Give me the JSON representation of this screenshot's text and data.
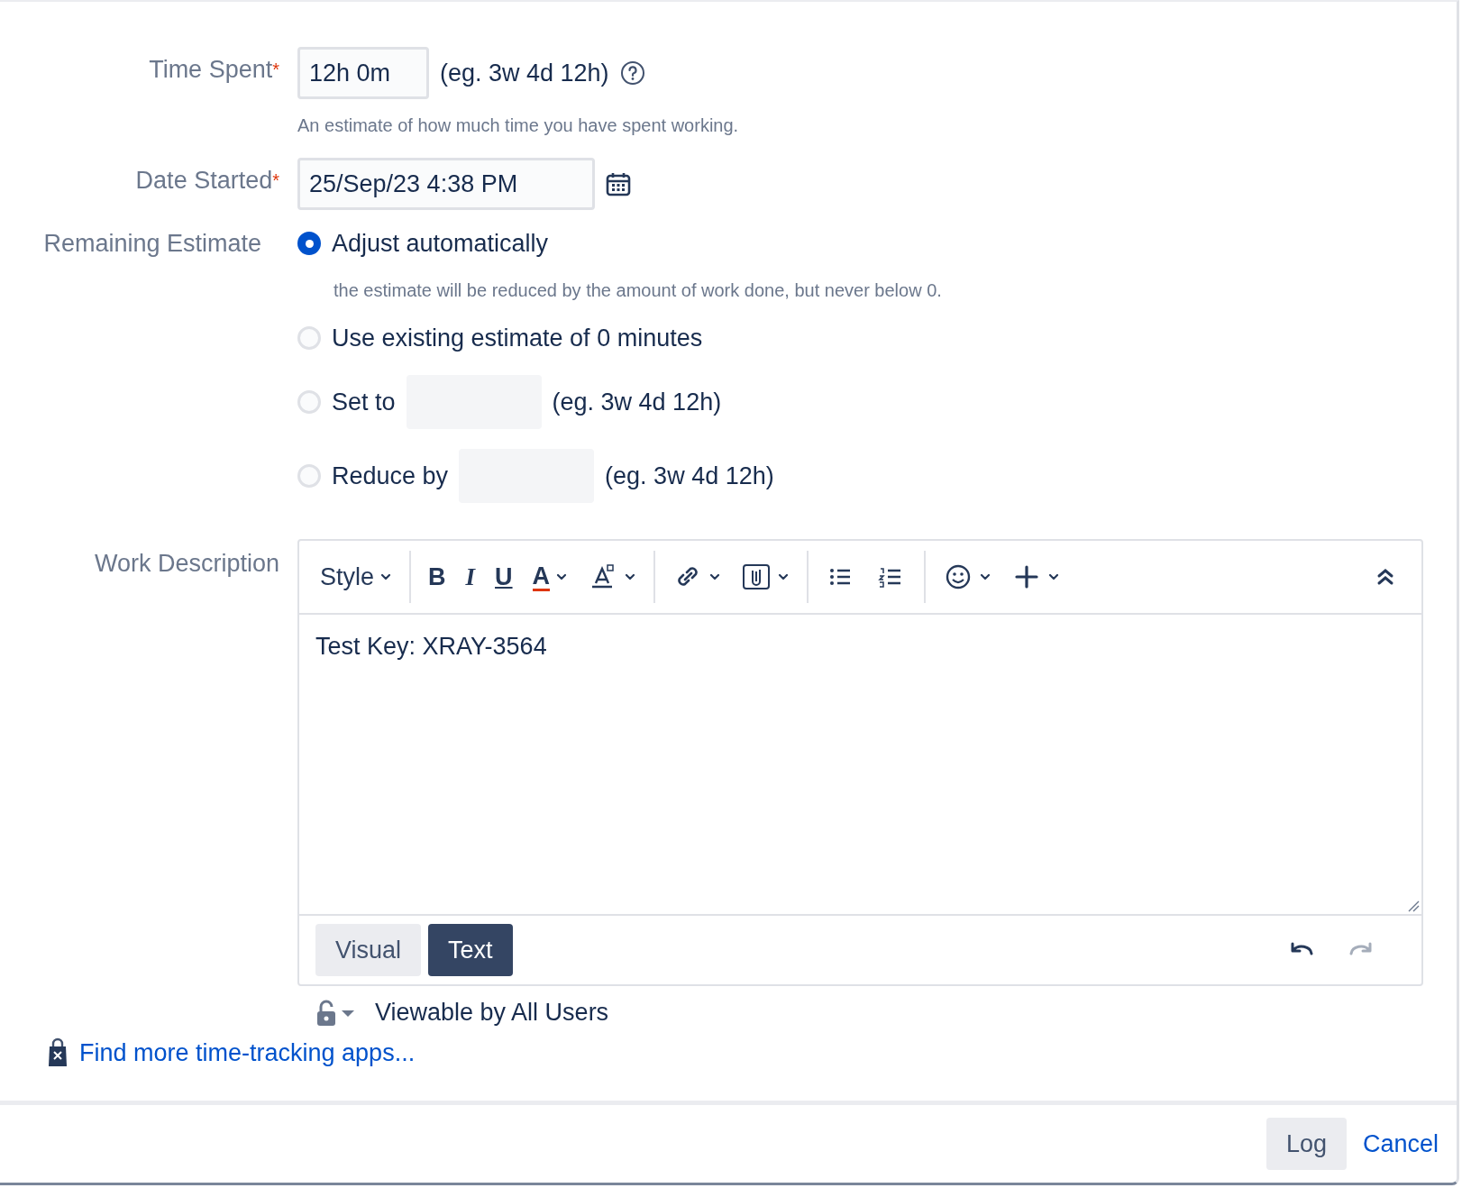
{
  "time_spent": {
    "label": "Time Spent",
    "required_mark": "*",
    "value": "12h 0m",
    "hint": "(eg. 3w 4d 12h)",
    "help": "An estimate of how much time you have spent working."
  },
  "date_started": {
    "label": "Date Started",
    "required_mark": "*",
    "value": "25/Sep/23 4:38 PM"
  },
  "remaining_estimate": {
    "label": "Remaining Estimate",
    "options": [
      {
        "kind": "plain",
        "label": "Adjust automatically",
        "selected": true,
        "description": "the estimate will be reduced by the amount of work done, but never below 0."
      },
      {
        "kind": "plain",
        "label": "Use existing estimate of 0 minutes",
        "selected": false
      },
      {
        "kind": "input",
        "label": "Set to",
        "selected": false,
        "hint": "(eg. 3w 4d 12h)"
      },
      {
        "kind": "input",
        "label": "Reduce by",
        "selected": false,
        "hint": "(eg. 3w 4d 12h)"
      }
    ]
  },
  "work_description": {
    "label": "Work Description",
    "toolbar": [
      {
        "kind": "style",
        "label": "Style"
      },
      {
        "kind": "divider"
      },
      {
        "kind": "bold",
        "label": "B"
      },
      {
        "kind": "italic",
        "label": "I"
      },
      {
        "kind": "underline",
        "label": "U"
      },
      {
        "kind": "color",
        "label": "A"
      },
      {
        "kind": "format"
      },
      {
        "kind": "divider"
      },
      {
        "kind": "link"
      },
      {
        "kind": "attachment"
      },
      {
        "kind": "divider"
      },
      {
        "kind": "bullets"
      },
      {
        "kind": "numbers"
      },
      {
        "kind": "divider"
      },
      {
        "kind": "emoji"
      },
      {
        "kind": "plus"
      },
      {
        "kind": "collapse"
      }
    ],
    "content": "Test Key: XRAY-3564",
    "modes": [
      {
        "label": "Visual",
        "selected": false
      },
      {
        "label": "Text",
        "selected": true
      }
    ],
    "undo": {
      "disabled": false
    },
    "redo": {
      "disabled": true
    },
    "visibility": "Viewable by All Users"
  },
  "more_apps_link": "Find more time-tracking apps...",
  "buttons": {
    "primary": "Log",
    "cancel": "Cancel"
  }
}
